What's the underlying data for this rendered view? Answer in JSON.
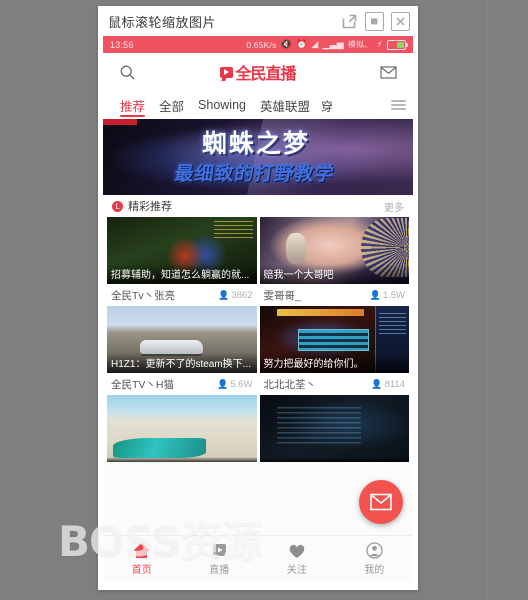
{
  "window": {
    "title": "鼠标滚轮缩放图片",
    "controls": [
      {
        "name": "popout",
        "label": "⧉"
      },
      {
        "name": "restore",
        "label": "▣"
      },
      {
        "name": "close",
        "label": "✕"
      }
    ]
  },
  "statusbar": {
    "time": "13:56",
    "speed": "0.65K/s",
    "icons": [
      "mute-icon",
      "alarm-icon",
      "wifi-icon",
      "signal-icon"
    ],
    "carrier": "模拟、",
    "charging": "⚡"
  },
  "appbar": {
    "search_icon": "search-icon",
    "logo_text": "全民直播",
    "mail_icon": "mail-icon"
  },
  "tabs": {
    "items": [
      {
        "label": "推荐",
        "active": true
      },
      {
        "label": "全部",
        "active": false
      },
      {
        "label": "Showing",
        "active": false
      },
      {
        "label": "英雄联盟",
        "active": false
      },
      {
        "label": "穿",
        "active": false
      }
    ],
    "menu_icon": "hamburger-menu-icon"
  },
  "banner": {
    "title": "蜘蛛之梦",
    "subtitle": "最细致的打野教学"
  },
  "section": {
    "badge": "L",
    "title": "精彩推荐",
    "more": "更多"
  },
  "cards": [
    {
      "caption": "招募辅助，知道怎么躺赢的就...",
      "streamer": "全民Tv丶张亮",
      "views": "3862",
      "art": "t-moba"
    },
    {
      "caption": "赔我一个大哥吧",
      "streamer": "雯哥哥_",
      "views": "1.5W",
      "art": "t-girl"
    },
    {
      "caption": "H1Z1：更新不了的steam换下...",
      "streamer": "全民TV丶H猫",
      "views": "5.6W",
      "art": "t-city"
    },
    {
      "caption": "努力把最好的给你们。",
      "streamer": "北北北荃丶",
      "views": "8114",
      "art": "t-game"
    },
    {
      "caption": "",
      "streamer": "",
      "views": "",
      "art": "t-beach"
    },
    {
      "caption": "",
      "streamer": "",
      "views": "",
      "art": "t-dark"
    }
  ],
  "fab": {
    "icon": "mail-icon"
  },
  "bottomnav": {
    "items": [
      {
        "label": "首页",
        "icon": "home-icon",
        "active": true
      },
      {
        "label": "直播",
        "icon": "live-play-icon",
        "active": false
      },
      {
        "label": "关注",
        "icon": "heart-icon",
        "active": false
      },
      {
        "label": "我的",
        "icon": "person-icon",
        "active": false
      }
    ]
  },
  "watermark": {
    "part1": "BOSS",
    "part2": "资源"
  }
}
